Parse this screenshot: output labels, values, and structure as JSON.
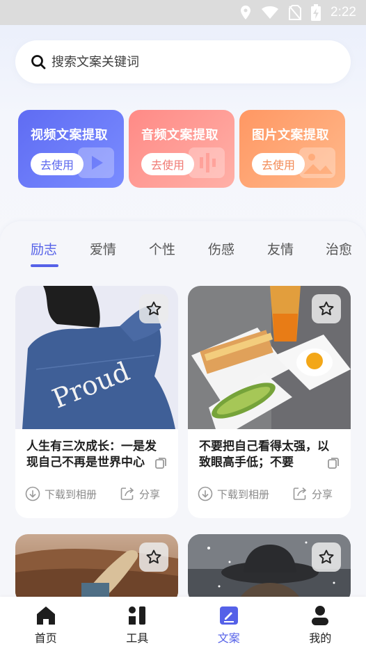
{
  "status_bar": {
    "time": "2:22"
  },
  "search": {
    "placeholder": "搜索文案关键词"
  },
  "features": [
    {
      "title": "视频文案提取",
      "button": "去使用"
    },
    {
      "title": "音频文案提取",
      "button": "去使用"
    },
    {
      "title": "图片文案提取",
      "button": "去使用"
    }
  ],
  "tabs": [
    "励志",
    "爱情",
    "个性",
    "伤感",
    "友情",
    "治愈"
  ],
  "active_tab": "励志",
  "cards": [
    {
      "image": "girl-proud-jacket-illustration",
      "image_text": "Proud",
      "text": "人生有三次成长：一是发现自己不再是世界中心",
      "download": "下载到相册",
      "share": "分享"
    },
    {
      "image": "breakfast-toast-kiwi-egg-photo",
      "text": "不要把自己看得太强，以致眼高手低；不要",
      "download": "下载到相册",
      "share": "分享"
    },
    {
      "image": "woman-desert-hair-wind-photo"
    },
    {
      "image": "man-hat-snow-photo"
    }
  ],
  "nav": [
    {
      "label": "首页",
      "icon": "home-icon"
    },
    {
      "label": "工具",
      "icon": "tools-icon"
    },
    {
      "label": "文案",
      "icon": "copywriting-icon"
    },
    {
      "label": "我的",
      "icon": "profile-icon"
    }
  ],
  "colors": {
    "accent": "#5561e8",
    "video_card": "#6a78f5",
    "audio_card": "#ff9c95",
    "image_card": "#ffa877"
  }
}
